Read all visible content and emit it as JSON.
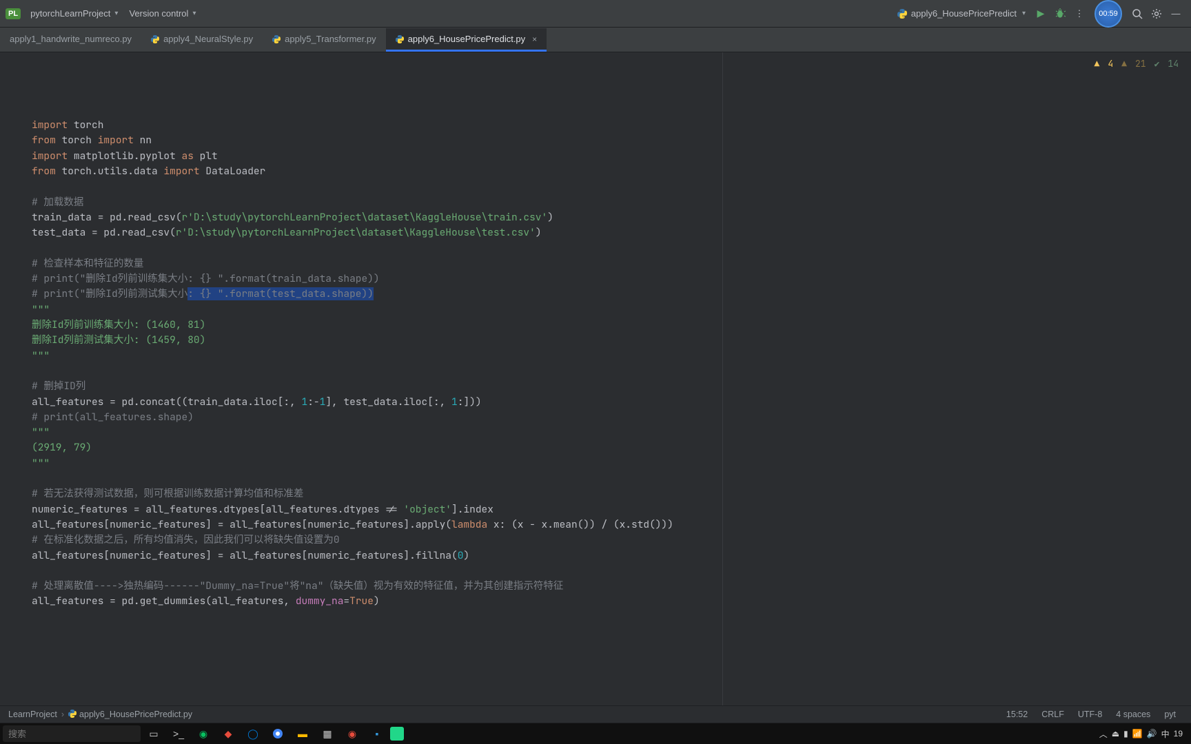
{
  "titlebar": {
    "project_badge": "PL",
    "project_name": "pytorchLearnProject",
    "vcs_label": "Version control",
    "run_config": "apply6_HousePricePredict",
    "timer": "00:59"
  },
  "tabs": [
    {
      "label": "apply1_handwrite_numreco.py",
      "active": false
    },
    {
      "label": "apply4_NeuralStyle.py",
      "active": false
    },
    {
      "label": "apply5_Transformer.py",
      "active": false
    },
    {
      "label": "apply6_HousePricePredict.py",
      "active": true
    }
  ],
  "inspections": {
    "warnings": "4",
    "weak_warnings": "21",
    "typos": "14"
  },
  "code_tokens": [
    [
      [
        "kw",
        "import"
      ],
      [
        "op",
        " torch"
      ]
    ],
    [
      [
        "kw",
        "from"
      ],
      [
        "op",
        " torch "
      ],
      [
        "kw",
        "import"
      ],
      [
        "op",
        " nn"
      ]
    ],
    [
      [
        "kw",
        "import"
      ],
      [
        "op",
        " matplotlib.pyplot "
      ],
      [
        "kw",
        "as"
      ],
      [
        "op",
        " plt"
      ]
    ],
    [
      [
        "kw",
        "from"
      ],
      [
        "op",
        " torch.utils.data "
      ],
      [
        "kw",
        "import"
      ],
      [
        "op",
        " DataLoader"
      ]
    ],
    [],
    [
      [
        "cmt",
        "# 加载数据"
      ]
    ],
    [
      [
        "op",
        "train_data = pd.read_csv("
      ],
      [
        "str",
        "r'D:\\study\\pytorchLearnProject\\dataset\\KaggleHouse\\train.csv'"
      ],
      [
        "op",
        ")"
      ]
    ],
    [
      [
        "op",
        "test_data = pd.read_csv("
      ],
      [
        "str",
        "r'D:\\study\\pytorchLearnProject\\dataset\\KaggleHouse\\test.csv'"
      ],
      [
        "op",
        ")"
      ]
    ],
    [],
    [
      [
        "cmt",
        "# 检查样本和特征的数量"
      ]
    ],
    [
      [
        "cmt",
        "# print(\"删除Id列前训练集大小: {} \".format(train_data.shape))"
      ]
    ],
    [
      [
        "cmt",
        "# print(\"删除Id列前测试集大小"
      ],
      [
        "cmt_sel",
        ": {} \".format(test_data.shape))"
      ]
    ],
    [
      [
        "str",
        "\"\"\""
      ]
    ],
    [
      [
        "str",
        "删除Id列前训练集大小: (1460, 81)"
      ]
    ],
    [
      [
        "str",
        "删除Id列前测试集大小: (1459, 80)"
      ]
    ],
    [
      [
        "str",
        "\"\"\""
      ]
    ],
    [],
    [
      [
        "cmt",
        "# 删掉ID列"
      ]
    ],
    [
      [
        "op",
        "all_features = pd.concat((train_data.iloc[:, "
      ],
      [
        "num",
        "1"
      ],
      [
        "op",
        ":-"
      ],
      [
        "num",
        "1"
      ],
      [
        "op",
        "], test_data.iloc[:, "
      ],
      [
        "num",
        "1"
      ],
      [
        "op",
        ":]))"
      ]
    ],
    [
      [
        "cmt",
        "# print(all_features.shape)"
      ]
    ],
    [
      [
        "str",
        "\"\"\""
      ]
    ],
    [
      [
        "str",
        "(2919, 79)"
      ]
    ],
    [
      [
        "str",
        "\"\"\""
      ]
    ],
    [],
    [
      [
        "cmt",
        "# 若无法获得测试数据，则可根据训练数据计算均值和标准差"
      ]
    ],
    [
      [
        "op",
        "numeric_features = all_features.dtypes[all_features.dtypes != "
      ],
      [
        "str",
        "'object'"
      ],
      [
        "op",
        "].index"
      ]
    ],
    [
      [
        "op",
        "all_features[numeric_features] = all_features[numeric_features].apply("
      ],
      [
        "kw",
        "lambda"
      ],
      [
        "op",
        " x: (x - x.mean()) / (x.std()))"
      ]
    ],
    [
      [
        "cmt",
        "# 在标准化数据之后，所有均值消失，因此我们可以将缺失值设置为0"
      ]
    ],
    [
      [
        "op",
        "all_features[numeric_features] = all_features[numeric_features].fillna("
      ],
      [
        "num",
        "0"
      ],
      [
        "op",
        ")"
      ]
    ],
    [],
    [
      [
        "cmt",
        "# 处理离散值---->独热编码------\"Dummy_na=True\"将\"na\"（缺失值）视为有效的特征值，并为其创建指示符特征"
      ]
    ],
    [
      [
        "op",
        "all_features = pd.get_dummies(all_features, "
      ],
      [
        "op2",
        "dummy_na"
      ],
      [
        "op",
        "="
      ],
      [
        "kw",
        "True"
      ],
      [
        "op",
        ")"
      ]
    ]
  ],
  "breadcrumb": {
    "project": "LearnProject",
    "file": "apply6_HousePricePredict.py"
  },
  "statusbar": {
    "time": "15:52",
    "line_sep": "CRLF",
    "encoding": "UTF-8",
    "indent": "4 spaces",
    "interp": "pyt"
  },
  "taskbar": {
    "search_placeholder": "搜索",
    "ime": "中",
    "date_hint": "19"
  }
}
